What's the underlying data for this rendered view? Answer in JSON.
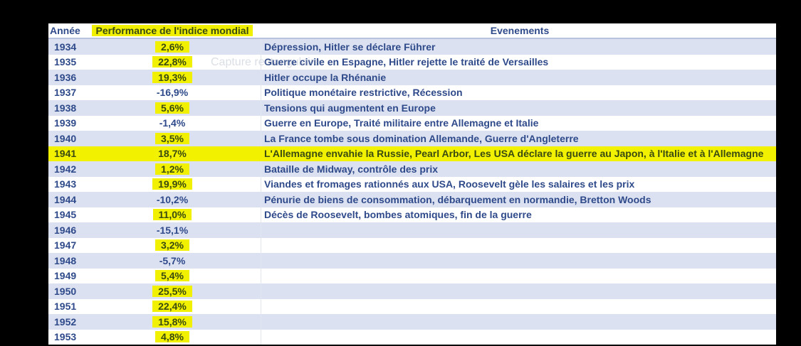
{
  "headers": {
    "year": "Année",
    "performance": "Performance de l'indice mondial",
    "events": "Evenements"
  },
  "watermark": "Capture rectangulaire",
  "colors": {
    "highlight": "#f0f000",
    "text": "#2f4a8a",
    "alt_row": "#dbe1f1"
  },
  "rows": [
    {
      "year": "1934",
      "perf": "2,6%",
      "event": "Dépression, Hitler se déclare Führer",
      "highlight": true
    },
    {
      "year": "1935",
      "perf": "22,8%",
      "event": "Guerre civile en Espagne, Hitler rejette le traité de Versailles",
      "highlight": true
    },
    {
      "year": "1936",
      "perf": "19,3%",
      "event": "Hitler occupe la Rhénanie",
      "highlight": true
    },
    {
      "year": "1937",
      "perf": "-16,9%",
      "event": "Politique monétaire restrictive, Récession",
      "highlight": false
    },
    {
      "year": "1938",
      "perf": "5,6%",
      "event": "Tensions qui augmentent en Europe",
      "highlight": true
    },
    {
      "year": "1939",
      "perf": "-1,4%",
      "event": "Guerre en Europe, Traité militaire entre Allemagne et Italie",
      "highlight": false
    },
    {
      "year": "1940",
      "perf": "3,5%",
      "event": "La France tombe sous domination Allemande, Guerre d'Angleterre",
      "highlight": true
    },
    {
      "year": "1941",
      "perf": "18,7%",
      "event": "L'Allemagne envahie la Russie, Pearl Arbor, Les USA déclare la guerre au Japon, à l'Italie et à l'Allemagne",
      "highlight": "row"
    },
    {
      "year": "1942",
      "perf": "1,2%",
      "event": "Bataille de Midway, contrôle des prix",
      "highlight": true
    },
    {
      "year": "1943",
      "perf": "19,9%",
      "event": "Viandes et fromages rationnés aux USA, Roosevelt gèle les salaires et les prix",
      "highlight": true
    },
    {
      "year": "1944",
      "perf": "-10,2%",
      "event": "Pénurie de biens de consommation, débarquement en normandie, Bretton Woods",
      "highlight": false
    },
    {
      "year": "1945",
      "perf": "11,0%",
      "event": "Décès de Roosevelt, bombes atomiques, fin de la guerre",
      "highlight": true
    },
    {
      "year": "1946",
      "perf": "-15,1%",
      "event": "",
      "highlight": false
    },
    {
      "year": "1947",
      "perf": "3,2%",
      "event": "",
      "highlight": true
    },
    {
      "year": "1948",
      "perf": "-5,7%",
      "event": "",
      "highlight": false
    },
    {
      "year": "1949",
      "perf": "5,4%",
      "event": "",
      "highlight": true
    },
    {
      "year": "1950",
      "perf": "25,5%",
      "event": "",
      "highlight": true
    },
    {
      "year": "1951",
      "perf": "22,4%",
      "event": "",
      "highlight": true
    },
    {
      "year": "1952",
      "perf": "15,8%",
      "event": "",
      "highlight": true
    },
    {
      "year": "1953",
      "perf": "4,8%",
      "event": "",
      "highlight": true
    }
  ]
}
